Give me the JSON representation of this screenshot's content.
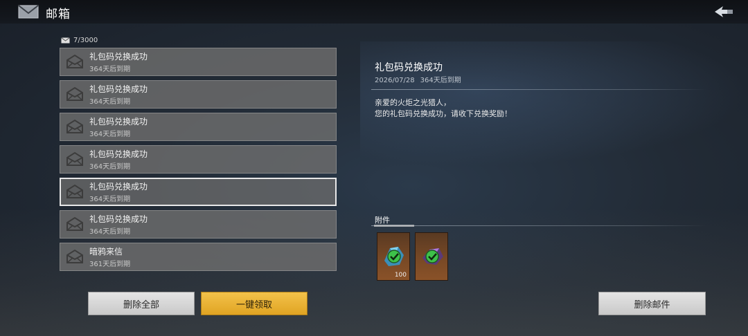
{
  "header": {
    "title": "邮箱"
  },
  "mailbox": {
    "count_text": "7/3000"
  },
  "mails": [
    {
      "title": "礼包码兑换成功",
      "expiry": "364天后到期"
    },
    {
      "title": "礼包码兑换成功",
      "expiry": "364天后到期"
    },
    {
      "title": "礼包码兑换成功",
      "expiry": "364天后到期"
    },
    {
      "title": "礼包码兑换成功",
      "expiry": "364天后到期"
    },
    {
      "title": "礼包码兑换成功",
      "expiry": "364天后到期",
      "selected": true
    },
    {
      "title": "礼包码兑换成功",
      "expiry": "364天后到期"
    },
    {
      "title": "暗鸦来信",
      "expiry": "361天后到期"
    }
  ],
  "detail": {
    "title": "礼包码兑换成功",
    "date": "2026/07/28",
    "expiry": "364天后到期",
    "body_line1": "亲爱的火炬之光猎人，",
    "body_line2": "您的礼包码兑换成功，请收下兑换奖励！",
    "attachments_label": "附件",
    "attachments": [
      {
        "icon": "blue-crystal-item-icon",
        "quantity": "100",
        "claimed": true
      },
      {
        "icon": "purple-crystal-item-icon",
        "quantity": "",
        "claimed": true
      }
    ]
  },
  "buttons": {
    "delete_all": "删除全部",
    "claim_all": "一键领取",
    "delete_mail": "删除邮件"
  },
  "colors": {
    "accent_gold": "#e8b033",
    "check_green": "#3ec24a",
    "slot_brown": "#7a4a26"
  }
}
